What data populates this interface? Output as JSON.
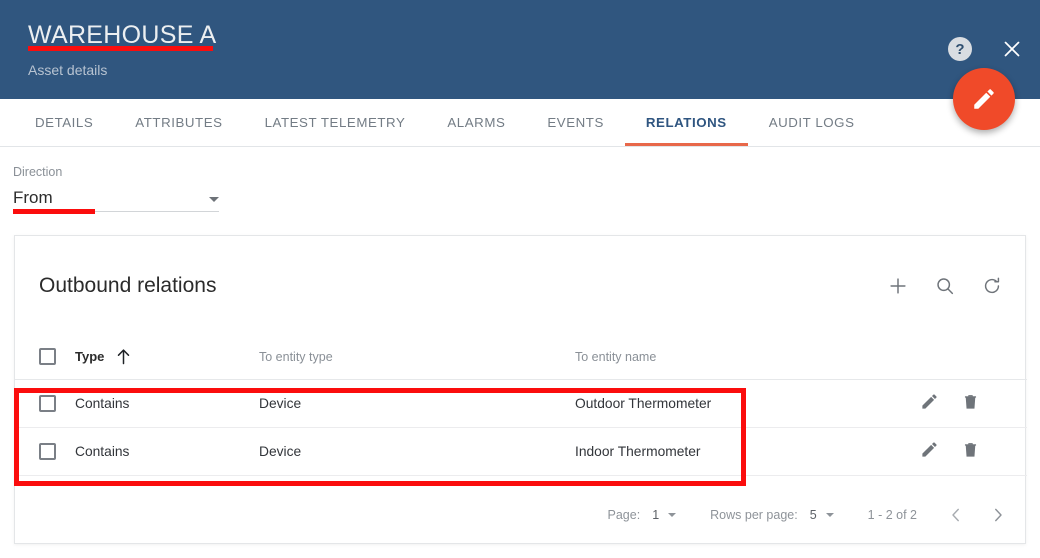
{
  "header": {
    "title": "WAREHOUSE A",
    "subtitle": "Asset details",
    "help_icon": "help-circle-icon",
    "help_glyph": "?",
    "close_icon": "close-icon",
    "fab_icon": "pencil-icon",
    "background_color": "#30567f",
    "annotation_color": "#fb0d0d"
  },
  "tabs": [
    {
      "label": "DETAILS",
      "active": false
    },
    {
      "label": "ATTRIBUTES",
      "active": false
    },
    {
      "label": "LATEST TELEMETRY",
      "active": false
    },
    {
      "label": "ALARMS",
      "active": false
    },
    {
      "label": "EVENTS",
      "active": false
    },
    {
      "label": "RELATIONS",
      "active": true
    },
    {
      "label": "AUDIT LOGS",
      "active": false
    }
  ],
  "tab_accent_color": "#e8684a",
  "tab_active_color": "#2f5580",
  "direction": {
    "label": "Direction",
    "value": "From",
    "caret_icon": "chevron-down-icon"
  },
  "card": {
    "title": "Outbound relations",
    "actions": [
      {
        "name": "add-relation-button",
        "icon": "plus-icon"
      },
      {
        "name": "search-button",
        "icon": "search-icon"
      },
      {
        "name": "refresh-button",
        "icon": "refresh-icon"
      }
    ]
  },
  "table": {
    "columns": [
      {
        "key": "type",
        "label": "Type",
        "sorted": true,
        "sort_icon": "arrow-up-icon"
      },
      {
        "key": "to_entity_type",
        "label": "To entity type",
        "sorted": false
      },
      {
        "key": "to_entity_name",
        "label": "To entity name",
        "sorted": false
      }
    ],
    "rows": [
      {
        "type": "Contains",
        "to_entity_type": "Device",
        "to_entity_name": "Outdoor Thermometer"
      },
      {
        "type": "Contains",
        "to_entity_type": "Device",
        "to_entity_name": "Indoor Thermometer"
      }
    ],
    "row_actions": [
      {
        "name": "edit-relation-button",
        "icon": "pencil-icon"
      },
      {
        "name": "delete-relation-button",
        "icon": "trash-icon"
      }
    ]
  },
  "paginator": {
    "page_label": "Page:",
    "page_value": "1",
    "rows_per_page_label": "Rows per page:",
    "rows_per_page_value": "5",
    "range_label": "1 - 2 of 2",
    "prev_icon": "chevron-left-icon",
    "next_icon": "chevron-right-icon"
  }
}
